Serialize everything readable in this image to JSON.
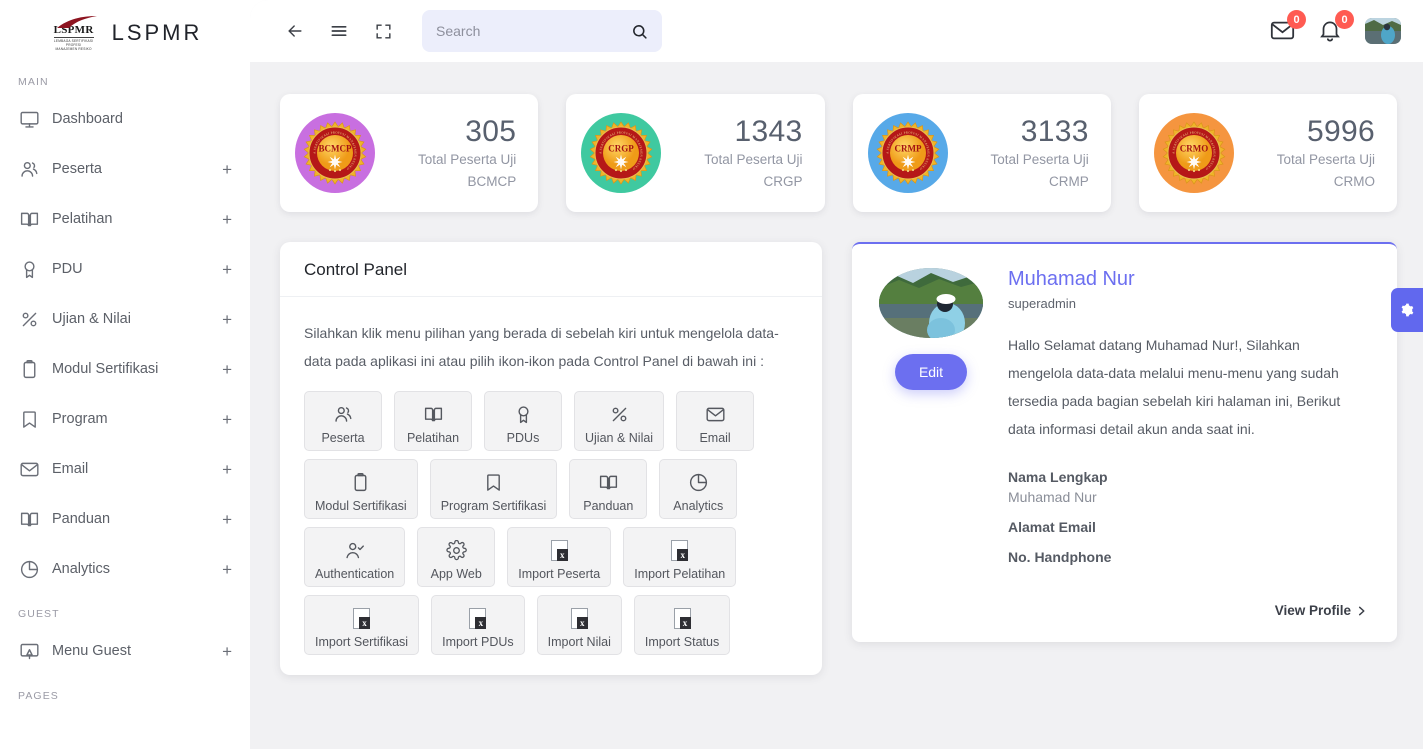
{
  "brand": {
    "logo_text": "LSPMR",
    "logo_sub": "LEMBAGA SERTIFIKASI PROFESI\nMANAJEMEN RESIKO",
    "name": "LSPMR"
  },
  "sidebar": {
    "sections": [
      {
        "label": "MAIN",
        "items": [
          {
            "label": "Dashboard",
            "icon": "monitor-icon",
            "expandable": false
          },
          {
            "label": "Peserta",
            "icon": "users-icon",
            "expandable": true
          },
          {
            "label": "Pelatihan",
            "icon": "book-icon",
            "expandable": true
          },
          {
            "label": "PDU",
            "icon": "award-icon",
            "expandable": true
          },
          {
            "label": "Ujian & Nilai",
            "icon": "percent-icon",
            "expandable": true
          },
          {
            "label": "Modul Sertifikasi",
            "icon": "clipboard-icon",
            "expandable": true
          },
          {
            "label": "Program",
            "icon": "bookmark-icon",
            "expandable": true
          },
          {
            "label": "Email",
            "icon": "envelope-icon",
            "expandable": true
          },
          {
            "label": "Panduan",
            "icon": "book-icon",
            "expandable": true
          },
          {
            "label": "Analytics",
            "icon": "pie-chart-icon",
            "expandable": true
          }
        ]
      },
      {
        "label": "GUEST",
        "items": [
          {
            "label": "Menu Guest",
            "icon": "monitor-guest-icon",
            "expandable": true
          }
        ]
      },
      {
        "label": "PAGES",
        "items": []
      }
    ],
    "expand_symbol": "+"
  },
  "topbar": {
    "back_icon": "arrow-left-icon",
    "menu_icon": "hamburger-icon",
    "fullscreen_icon": "fullscreen-icon",
    "search": {
      "value": "",
      "placeholder": "Search",
      "icon": "search-icon"
    },
    "mail": {
      "icon": "envelope-icon",
      "count": "0"
    },
    "notifications": {
      "icon": "bell-icon",
      "count": "0"
    },
    "avatar_icon": "user-avatar"
  },
  "stats": [
    {
      "code": "BCMCP",
      "value": "305",
      "label_line1": "Total Peserta Uji",
      "label_line2": "BCMCP",
      "ring_color": "#c86fe0"
    },
    {
      "code": "CRGP",
      "value": "1343",
      "label_line1": "Total Peserta Uji",
      "label_line2": "CRGP",
      "ring_color": "#3fc9a0"
    },
    {
      "code": "CRMP",
      "value": "3133",
      "label_line1": "Total Peserta Uji",
      "label_line2": "CRMP",
      "ring_color": "#57a9e8"
    },
    {
      "code": "CRMO",
      "value": "5996",
      "label_line1": "Total Peserta Uji",
      "label_line2": "CRMO",
      "ring_color": "#f5953f"
    }
  ],
  "control_panel": {
    "title": "Control Panel",
    "description": "Silahkan klik menu pilihan yang berada di sebelah kiri untuk mengelola data-data pada aplikasi ini atau pilih ikon-ikon pada Control Panel di bawah ini :",
    "buttons": [
      {
        "label": "Peserta",
        "icon": "users-icon"
      },
      {
        "label": "Pelatihan",
        "icon": "book-icon"
      },
      {
        "label": "PDUs",
        "icon": "award-icon"
      },
      {
        "label": "Ujian & Nilai",
        "icon": "percent-icon"
      },
      {
        "label": "Email",
        "icon": "envelope-icon"
      },
      {
        "label": "Modul Sertifikasi",
        "icon": "clipboard-icon"
      },
      {
        "label": "Program Sertifikasi",
        "icon": "bookmark-icon"
      },
      {
        "label": "Panduan",
        "icon": "book-icon"
      },
      {
        "label": "Analytics",
        "icon": "pie-chart-icon"
      },
      {
        "label": "Authentication",
        "icon": "user-check-icon"
      },
      {
        "label": "App Web",
        "icon": "gear-icon"
      },
      {
        "label": "Import Peserta",
        "icon": "excel-file-icon"
      },
      {
        "label": "Import Pelatihan",
        "icon": "excel-file-icon"
      },
      {
        "label": "Import Sertifikasi",
        "icon": "excel-file-icon"
      },
      {
        "label": "Import PDUs",
        "icon": "excel-file-icon"
      },
      {
        "label": "Import Nilai",
        "icon": "excel-file-icon"
      },
      {
        "label": "Import Status",
        "icon": "excel-file-icon"
      }
    ]
  },
  "profile": {
    "name": "Muhamad Nur",
    "role": "superadmin",
    "edit_label": "Edit",
    "greeting": "Hallo Selamat datang Muhamad Nur!, Silahkan mengelola data-data melalui menu-menu yang sudah tersedia pada bagian sebelah kiri halaman ini, Berikut data informasi detail akun anda saat ini.",
    "fields": [
      {
        "label": "Nama Lengkap",
        "value": "Muhamad Nur"
      },
      {
        "label": "Alamat Email",
        "value": ""
      },
      {
        "label": "No. Handphone",
        "value": ""
      }
    ],
    "view_profile": "View Profile",
    "chevron_icon": "chevron-right-icon",
    "accent_color": "#6c6ff0"
  },
  "settings_tab": {
    "icon": "gear-icon"
  }
}
